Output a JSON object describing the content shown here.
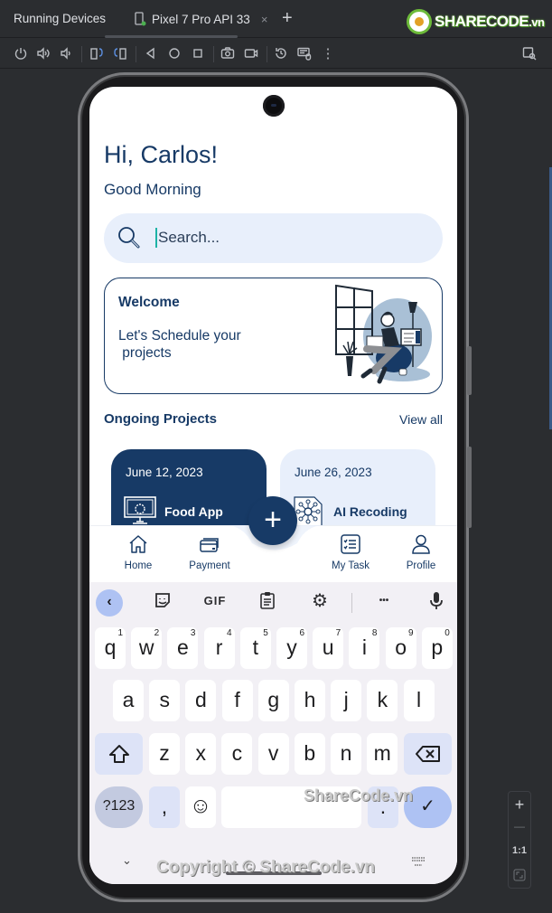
{
  "ide": {
    "panel_title": "Running Devices",
    "device_tab": "Pixel 7 Pro API 33",
    "tab_close": "×",
    "tab_add": "+",
    "toolbar_icons": [
      "power-icon",
      "volume-up-icon",
      "volume-down-icon",
      "rotate-left-icon",
      "rotate-right-icon",
      "back-icon",
      "home-icon",
      "overview-icon",
      "screenshot-icon",
      "screen-record-icon",
      "reset-icon",
      "keyboard-mouse-icon",
      "more-icon"
    ],
    "zoom_panel": {
      "zoom_in": "+",
      "zoom_out": "—",
      "actual_size": "1:1"
    }
  },
  "watermark": {
    "logo_text": "SHARECODE",
    "logo_suffix": ".vn",
    "middle": "ShareCode.vn",
    "bottom": "Copyright © ShareCode.vn"
  },
  "app": {
    "greeting": "Hi, Carlos!",
    "subgreeting": "Good Morning",
    "search": {
      "placeholder": "Search..."
    },
    "welcome": {
      "title": "Welcome",
      "text": "Let's Schedule your\n projects"
    },
    "ongoing": {
      "title": "Ongoing Projects",
      "view_all": "View all"
    },
    "projects": [
      {
        "date": "June 12, 2023",
        "name": "Food App",
        "icon": "monitor-gear-icon"
      },
      {
        "date": "June 26, 2023",
        "name": "AI Recoding",
        "icon": "network-document-icon"
      }
    ],
    "nav": [
      {
        "label": "Home",
        "icon": "home-icon"
      },
      {
        "label": "Payment",
        "icon": "cards-icon"
      },
      {
        "label": "My Task",
        "icon": "task-list-icon"
      },
      {
        "label": "Profile",
        "icon": "profile-icon"
      }
    ],
    "fab": "+",
    "colors": {
      "primary": "#173a66",
      "light": "#e8effb",
      "caret": "#1db3a6"
    }
  },
  "keyboard": {
    "toolbar": {
      "gif": "GIF",
      "more": "•••"
    },
    "row1": [
      {
        "k": "q",
        "n": "1"
      },
      {
        "k": "w",
        "n": "2"
      },
      {
        "k": "e",
        "n": "3"
      },
      {
        "k": "r",
        "n": "4"
      },
      {
        "k": "t",
        "n": "5"
      },
      {
        "k": "y",
        "n": "6"
      },
      {
        "k": "u",
        "n": "7"
      },
      {
        "k": "i",
        "n": "8"
      },
      {
        "k": "o",
        "n": "9"
      },
      {
        "k": "p",
        "n": "0"
      }
    ],
    "row2": [
      "a",
      "s",
      "d",
      "f",
      "g",
      "h",
      "j",
      "k",
      "l"
    ],
    "row3": [
      "z",
      "x",
      "c",
      "v",
      "b",
      "n",
      "m"
    ],
    "symbols": "?123",
    "comma": ",",
    "period": ".",
    "emoji": "☺",
    "enter": "✓"
  }
}
